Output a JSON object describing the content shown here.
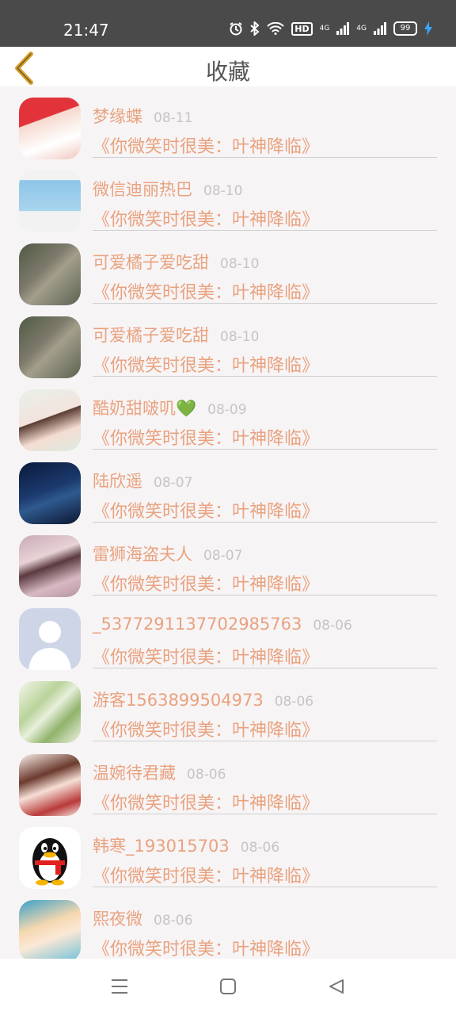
{
  "status_bar": {
    "time": "21:47",
    "hd_label": "HD",
    "network_1": "4G",
    "network_2": "4G",
    "battery": "99",
    "icons": [
      "alarm-icon",
      "bluetooth-icon",
      "wifi-icon",
      "signal-icon",
      "signal-icon",
      "battery-icon",
      "charging-icon"
    ]
  },
  "header": {
    "title": "收藏",
    "back_icon": "chevron-left-icon",
    "accent": "#d9a12a"
  },
  "list": {
    "items": [
      {
        "name": "梦缘蝶",
        "date": "08-11",
        "book": "《你微笑时很美：叶神降临》"
      },
      {
        "name": "微信迪丽热巴",
        "date": "08-10",
        "book": "《你微笑时很美：叶神降临》"
      },
      {
        "name": "可爱橘子爱吃甜",
        "date": "08-10",
        "book": "《你微笑时很美：叶神降临》"
      },
      {
        "name": "可爱橘子爱吃甜",
        "date": "08-10",
        "book": "《你微笑时很美：叶神降临》"
      },
      {
        "name": "酷奶甜啵叽💚",
        "date": "08-09",
        "book": "《你微笑时很美：叶神降临》"
      },
      {
        "name": "陆欣遥",
        "date": "08-07",
        "book": "《你微笑时很美：叶神降临》"
      },
      {
        "name": "雷狮海盗夫人",
        "date": "08-07",
        "book": "《你微笑时很美：叶神降临》"
      },
      {
        "name": "_5377291137702985763",
        "date": "08-06",
        "book": "《你微笑时很美：叶神降临》"
      },
      {
        "name": "游客1563899504973",
        "date": "08-06",
        "book": "《你微笑时很美：叶神降临》"
      },
      {
        "name": "温婉待君藏",
        "date": "08-06",
        "book": "《你微笑时很美：叶神降临》"
      },
      {
        "name": "韩寒_193015703",
        "date": "08-06",
        "book": "《你微笑时很美：叶神降临》"
      },
      {
        "name": "熙夜微",
        "date": "08-06",
        "book": "《你微笑时很美：叶神降临》"
      }
    ]
  },
  "nav_bar": {
    "icons": [
      "menu-icon",
      "home-square-icon",
      "back-triangle-icon"
    ]
  },
  "colors": {
    "name_text": "#e9a27f",
    "date_text": "#c5c5c5",
    "status_bar": "#4a4a4a",
    "background": "#f7f4f5"
  }
}
